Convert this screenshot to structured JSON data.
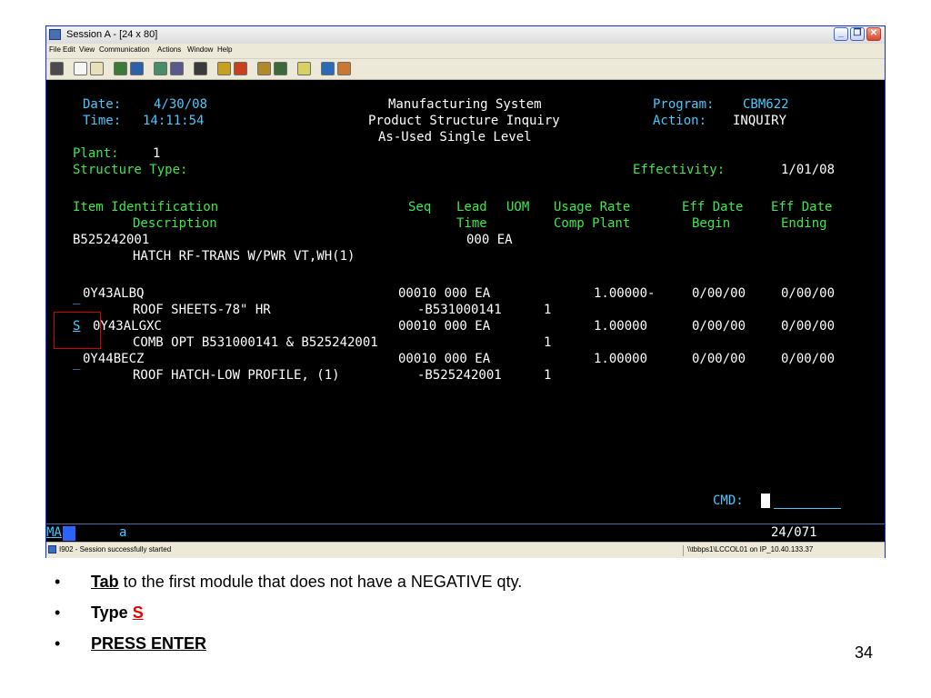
{
  "window": {
    "title": "Session A - [24 x 80]",
    "controls": {
      "minimize": "_",
      "restore": "❐",
      "close": "✕"
    }
  },
  "menu": [
    "File",
    "Edit",
    "View",
    "Communication",
    "Actions",
    "Window",
    "Help"
  ],
  "toolbar_icons": [
    "print-screen-icon",
    "copy-icon",
    "paste-icon",
    "send-icon",
    "receive-icon",
    "display-icon",
    "keypad-icon",
    "map-icon",
    "record-macro-icon",
    "stop-macro-icon",
    "play-macro-icon",
    "customize-icon",
    "help-icon",
    "about-icon"
  ],
  "terminal": {
    "date_label": "Date:",
    "date_value": "4/30/08",
    "time_label": "Time:",
    "time_value": "14:11:54",
    "system_title": "Manufacturing System",
    "inquiry_title": "Product Structure Inquiry",
    "level_title": "As-Used Single Level",
    "program_label": "Program:",
    "program_value": "CBM622",
    "action_label": "Action:",
    "action_value": "INQUIRY",
    "plant_label": "Plant:",
    "plant_value": "1",
    "structure_type_label": "Structure Type:",
    "effectivity_label": "Effectivity:",
    "effectivity_value": "1/01/08",
    "headers_row1": {
      "item_identification": "Item Identification",
      "seq": "Seq",
      "lead": "Lead",
      "uom": "UOM",
      "usage_rate": "Usage Rate",
      "eff_date_begin": "Eff Date",
      "eff_date_end": "Eff Date"
    },
    "headers_row2": {
      "description": "Description",
      "time": "Time",
      "comp_plant": "Comp Plant",
      "begin": "Begin",
      "ending": "Ending"
    },
    "parent_item": "B525242001",
    "parent_lead_uom": "000 EA",
    "parent_description": "HATCH RF-TRANS W/PWR VT,WH(1)",
    "rows": [
      {
        "selector": "_",
        "item": "0Y43ALBQ",
        "seq_lead_uom": "00010 000 EA",
        "usage": "1.00000-",
        "eff_begin": "0/00/00",
        "eff_end": "0/00/00",
        "description": "ROOF SHEETS-78\" HR",
        "ref": "-B531000141",
        "comp_plant": "1"
      },
      {
        "selector": "S",
        "item": "0Y43ALGXC",
        "seq_lead_uom": "00010 000 EA",
        "usage": "1.00000",
        "eff_begin": "0/00/00",
        "eff_end": "0/00/00",
        "description": "COMB OPT B531000141 & B525242001",
        "ref": "",
        "comp_plant": "1"
      },
      {
        "selector": "_",
        "item": "0Y44BECZ",
        "seq_lead_uom": "00010 000 EA",
        "usage": "1.00000",
        "eff_begin": "0/00/00",
        "eff_end": "0/00/00",
        "description": "ROOF HATCH-LOW PROFILE, (1)",
        "ref": "-B525242001",
        "comp_plant": "1"
      }
    ],
    "cmd_label": "CMD:"
  },
  "oia": {
    "left": "MA",
    "input": "a",
    "position": "24/071"
  },
  "status": {
    "left": "I902 - Session successfully started",
    "right": "\\\\tbbps1\\LCCOL01 on IP_10.40.133.37"
  },
  "instructions": {
    "bullet": "•",
    "line1_key": "Tab",
    "line1_rest": " to the first module that does not have a NEGATIVE qty.",
    "line2_prefix": "Type ",
    "line2_key": "S",
    "line3": "PRESS ENTER"
  },
  "page_number": "34",
  "colors": {
    "terminal_bg": "#000000",
    "label_cyan": "#45c9ff",
    "field_green": "#3de84d",
    "value_white": "#ffffff",
    "highlight_red": "#d60000"
  }
}
